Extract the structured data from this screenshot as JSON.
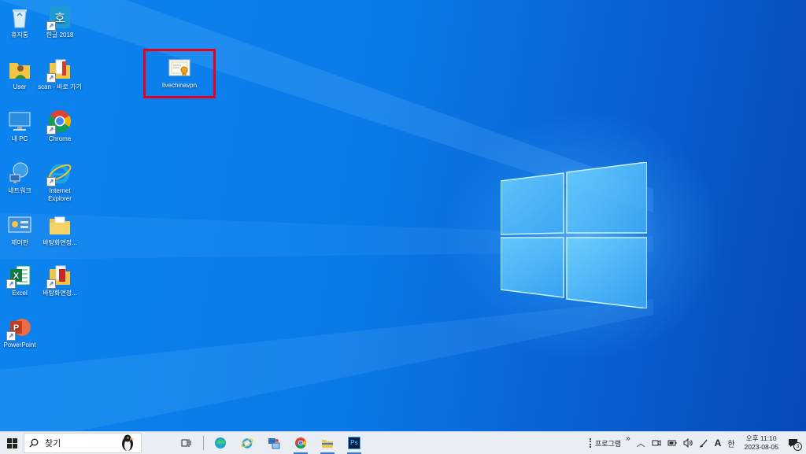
{
  "desktop": {
    "icons": [
      {
        "label": "휴지통"
      },
      {
        "label": "한글 2018",
        "glyph": "호"
      },
      {
        "label": "User"
      },
      {
        "label": "scan - 바로 가기"
      },
      {
        "label": "내 PC"
      },
      {
        "label": "Chrome"
      },
      {
        "label": "네트워크"
      },
      {
        "label": "Internet Explorer"
      },
      {
        "label": "제어판"
      },
      {
        "label": "바탕화면정..."
      },
      {
        "label": "Excel",
        "glyph": "X"
      },
      {
        "label": "바탕화면정..."
      },
      {
        "label": "PowerPoint",
        "glyph": "P"
      },
      {
        "label": "livechinavpn"
      }
    ]
  },
  "taskbar": {
    "search_placeholder": "찾기",
    "toolbar_label": "프로그램",
    "toolbar_chevron": "»",
    "ime": "A",
    "lang": "한",
    "time": "오후 11:10",
    "date": "2023-08-05",
    "notif_count": "3",
    "ps_label": "Ps"
  },
  "colors": {
    "highlight": "#e8001a",
    "accent": "#3b78d8"
  }
}
